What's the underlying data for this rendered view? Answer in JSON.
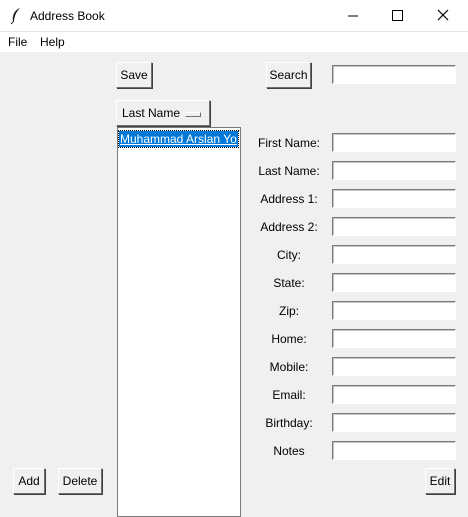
{
  "window": {
    "title": "Address Book",
    "icons": {
      "app": "feather-icon",
      "minimize": "minimize-icon",
      "maximize": "maximize-icon",
      "close": "close-icon"
    }
  },
  "menubar": {
    "file": "File",
    "help": "Help"
  },
  "toolbar": {
    "save_label": "Save",
    "search_label": "Search",
    "search_value": ""
  },
  "sort_menu": {
    "selected": "Last Name"
  },
  "contacts": {
    "items": [
      "Muhammad Arslan Yo"
    ],
    "selected_index": 0
  },
  "form": {
    "labels": {
      "first_name": "First Name:",
      "last_name": "Last Name:",
      "address1": "Address 1:",
      "address2": "Address 2:",
      "city": "City:",
      "state": "State:",
      "zip": "Zip:",
      "home": "Home:",
      "mobile": "Mobile:",
      "email": "Email:",
      "birthday": "Birthday:",
      "notes": "Notes"
    },
    "values": {
      "first_name": "",
      "last_name": "",
      "address1": "",
      "address2": "",
      "city": "",
      "state": "",
      "zip": "",
      "home": "",
      "mobile": "",
      "email": "",
      "birthday": "",
      "notes": ""
    }
  },
  "buttons": {
    "add": "Add",
    "delete": "Delete",
    "edit": "Edit"
  }
}
